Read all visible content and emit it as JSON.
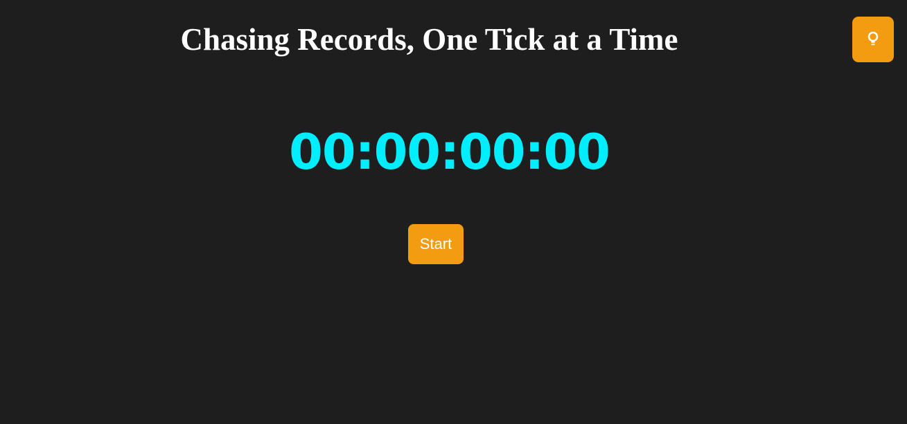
{
  "header": {
    "title": "Chasing Records, One Tick at a Time",
    "theme_toggle_icon": "lightbulb-icon"
  },
  "stopwatch": {
    "display": "00:00:00:00",
    "start_label": "Start"
  },
  "colors": {
    "background": "#1e1e1e",
    "accent": "#f39c12",
    "timer": "#00eeff",
    "text": "#ffffff"
  }
}
